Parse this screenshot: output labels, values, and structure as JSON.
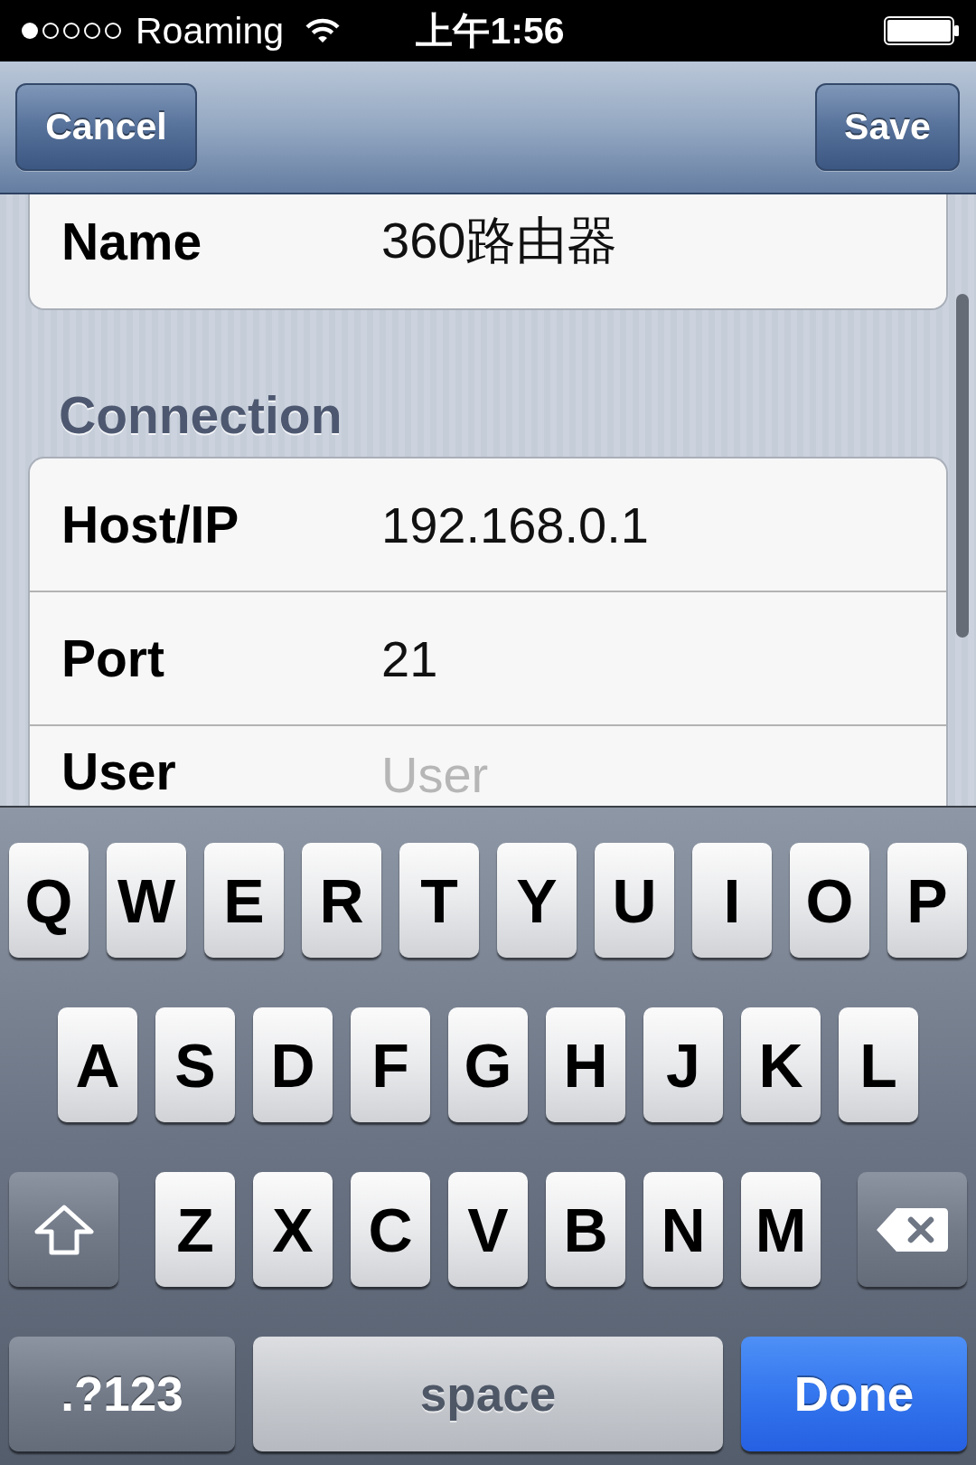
{
  "status_bar": {
    "carrier": "Roaming",
    "time": "上午1:56"
  },
  "nav_bar": {
    "left_button": "Cancel",
    "right_button": "Save"
  },
  "form": {
    "sections": [
      {
        "rows": [
          {
            "label": "Name",
            "value": "360路由器"
          }
        ]
      },
      {
        "header": "Connection",
        "rows": [
          {
            "label": "Host/IP",
            "value": "192.168.0.1"
          },
          {
            "label": "Port",
            "value": "21"
          },
          {
            "label": "User",
            "placeholder": "User"
          }
        ]
      }
    ]
  },
  "keyboard": {
    "letter_rows": [
      [
        {
          "kind": "letter",
          "label": "Q"
        },
        {
          "kind": "letter",
          "label": "W"
        },
        {
          "kind": "letter",
          "label": "E"
        },
        {
          "kind": "letter",
          "label": "R"
        },
        {
          "kind": "letter",
          "label": "T"
        },
        {
          "kind": "letter",
          "label": "Y"
        },
        {
          "kind": "letter",
          "label": "U"
        },
        {
          "kind": "letter",
          "label": "I"
        },
        {
          "kind": "letter",
          "label": "O"
        },
        {
          "kind": "letter",
          "label": "P"
        }
      ],
      [
        {
          "kind": "letter",
          "label": "A"
        },
        {
          "kind": "letter",
          "label": "S"
        },
        {
          "kind": "letter",
          "label": "D"
        },
        {
          "kind": "letter",
          "label": "F"
        },
        {
          "kind": "letter",
          "label": "G"
        },
        {
          "kind": "letter",
          "label": "H"
        },
        {
          "kind": "letter",
          "label": "J"
        },
        {
          "kind": "letter",
          "label": "K"
        },
        {
          "kind": "letter",
          "label": "L"
        }
      ],
      [
        {
          "kind": "shift"
        },
        {
          "kind": "letter",
          "label": "Z"
        },
        {
          "kind": "letter",
          "label": "X"
        },
        {
          "kind": "letter",
          "label": "C"
        },
        {
          "kind": "letter",
          "label": "V"
        },
        {
          "kind": "letter",
          "label": "B"
        },
        {
          "kind": "letter",
          "label": "N"
        },
        {
          "kind": "letter",
          "label": "M"
        },
        {
          "kind": "delete"
        }
      ]
    ],
    "bottom_row": [
      {
        "kind": "mode",
        "label": ".?123"
      },
      {
        "kind": "space",
        "label": "space"
      },
      {
        "kind": "done",
        "label": "Done"
      }
    ]
  }
}
